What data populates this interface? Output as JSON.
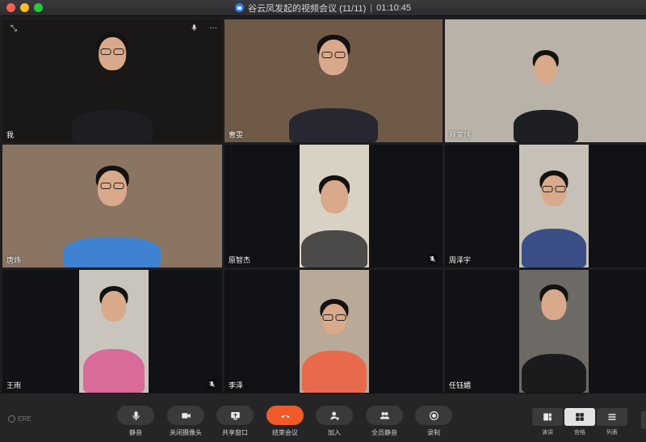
{
  "window": {
    "title": "谷云凤发起的视频会议 (11/11)",
    "separator": "|",
    "timer": "01:10:45"
  },
  "participants": [
    {
      "name": "我",
      "background": "#1a1816",
      "shirt": "#1d1d22",
      "muted": false
    },
    {
      "name": "曹雯",
      "background": "#6f5a48",
      "shirt": "#262730",
      "muted": false
    },
    {
      "name": "顾家玮",
      "background": "#b9b2a8",
      "shirt": "#1e1f22",
      "muted": false
    },
    {
      "name": "唐炜",
      "background": "#8a7563",
      "shirt": "#3f82d1",
      "muted": false
    },
    {
      "name": "原智杰",
      "background": "#d9d2c4",
      "shirt": "#4c4a48",
      "muted": true
    },
    {
      "name": "周泽宇",
      "background": "#c7c0b6",
      "shirt": "#3b4e86",
      "muted": false
    },
    {
      "name": "王雨",
      "background": "#c9c5bd",
      "shirt": "#d96a9a",
      "muted": true
    },
    {
      "name": "李泽",
      "background": "#b8a999",
      "shirt": "#e86a4c",
      "muted": false
    },
    {
      "name": "任钰媚",
      "background": "#6d6a66",
      "shirt": "#1b1b1d",
      "muted": false
    }
  ],
  "tile_tools": {
    "expand_icon": "expand-icon",
    "mic_icon": "mic-icon",
    "more_label": "···"
  },
  "toolbar": {
    "brand": "ERE",
    "mute": "静音",
    "camera_off": "关闭摄像头",
    "share_window": "共享窗口",
    "end_meeting": "结束会议",
    "join": "加入",
    "mute_all": "全员静音",
    "record": "录制"
  },
  "view_modes": {
    "speaker": "演讲",
    "gallery": "宫格",
    "list": "列表",
    "active": "gallery"
  },
  "colors": {
    "end_button": "#f05a28",
    "toolbar_bg": "#252528",
    "titlebar_text": "#d8d8d8"
  }
}
